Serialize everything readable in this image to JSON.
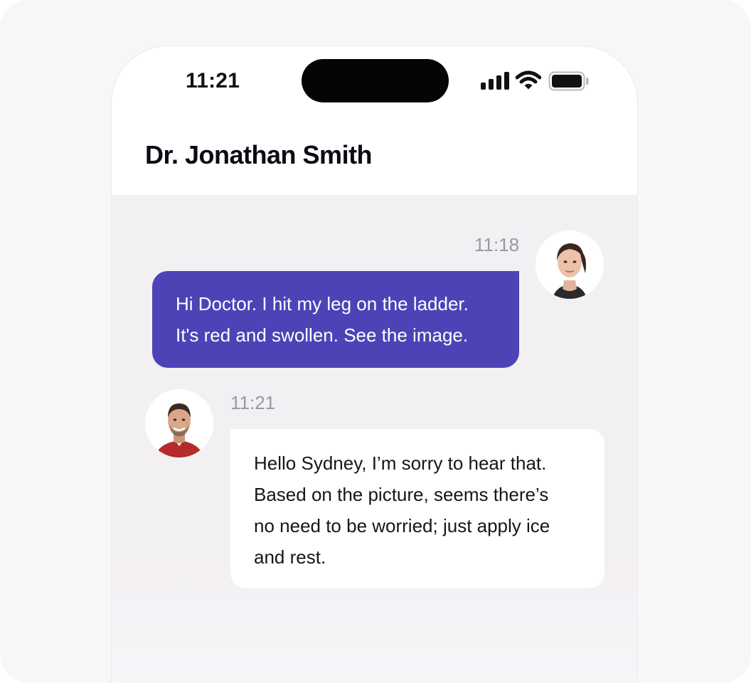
{
  "status_bar": {
    "time": "11:21",
    "icons": [
      "signal-icon",
      "wifi-icon",
      "battery-icon"
    ]
  },
  "header": {
    "title": "Dr. Jonathan Smith"
  },
  "messages": [
    {
      "sender": "patient",
      "time": "11:18",
      "lines": [
        "Hi Doctor. I hit my leg on the ladder.",
        "It's red and swollen. See the image."
      ],
      "bubble_color": "#4c43b7",
      "avatar": "patient-avatar"
    },
    {
      "sender": "doctor",
      "time": "11:21",
      "lines": [
        "Hello Sydney, I’m sorry to hear that.",
        "Based on the picture, seems there’s",
        "no need to be worried; just apply ice",
        "and rest."
      ],
      "bubble_color": "#ffffff",
      "avatar": "doctor-avatar"
    }
  ],
  "colors": {
    "accent": "#4c43b7",
    "chat_background": "#f3f0f4",
    "timestamp": "#9a98a0"
  }
}
